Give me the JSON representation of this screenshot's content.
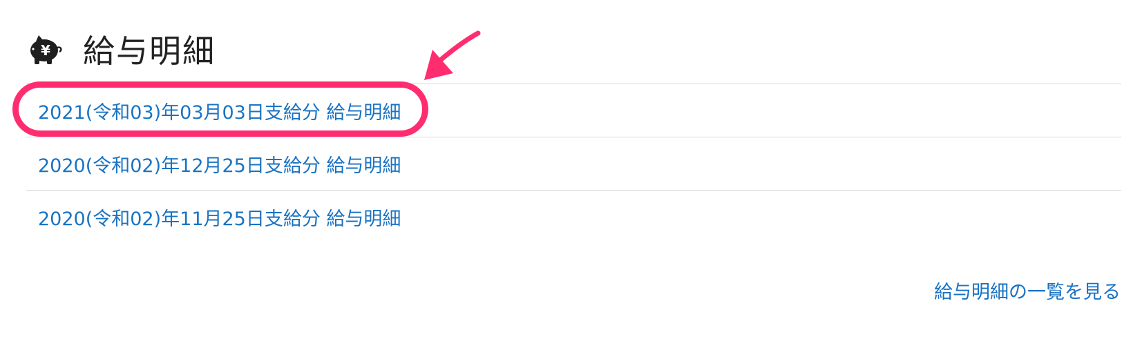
{
  "header": {
    "title": "給与明細",
    "icon": "piggy-bank-yen-icon",
    "icon_symbol": "¥"
  },
  "payslips": [
    {
      "label": "2021(令和03)年03月03日支給分 給与明細"
    },
    {
      "label": "2020(令和02)年12月25日支給分 給与明細"
    },
    {
      "label": "2020(令和02)年11月25日支給分 給与明細"
    }
  ],
  "footer": {
    "view_all_label": "給与明細の一覧を見る"
  },
  "annotation": {
    "highlight_color": "#ff2d6f",
    "arrow_icon": "pointer-arrow-icon"
  },
  "colors": {
    "link": "#1a73c2",
    "title": "#222222",
    "divider": "#d6d6d6"
  }
}
